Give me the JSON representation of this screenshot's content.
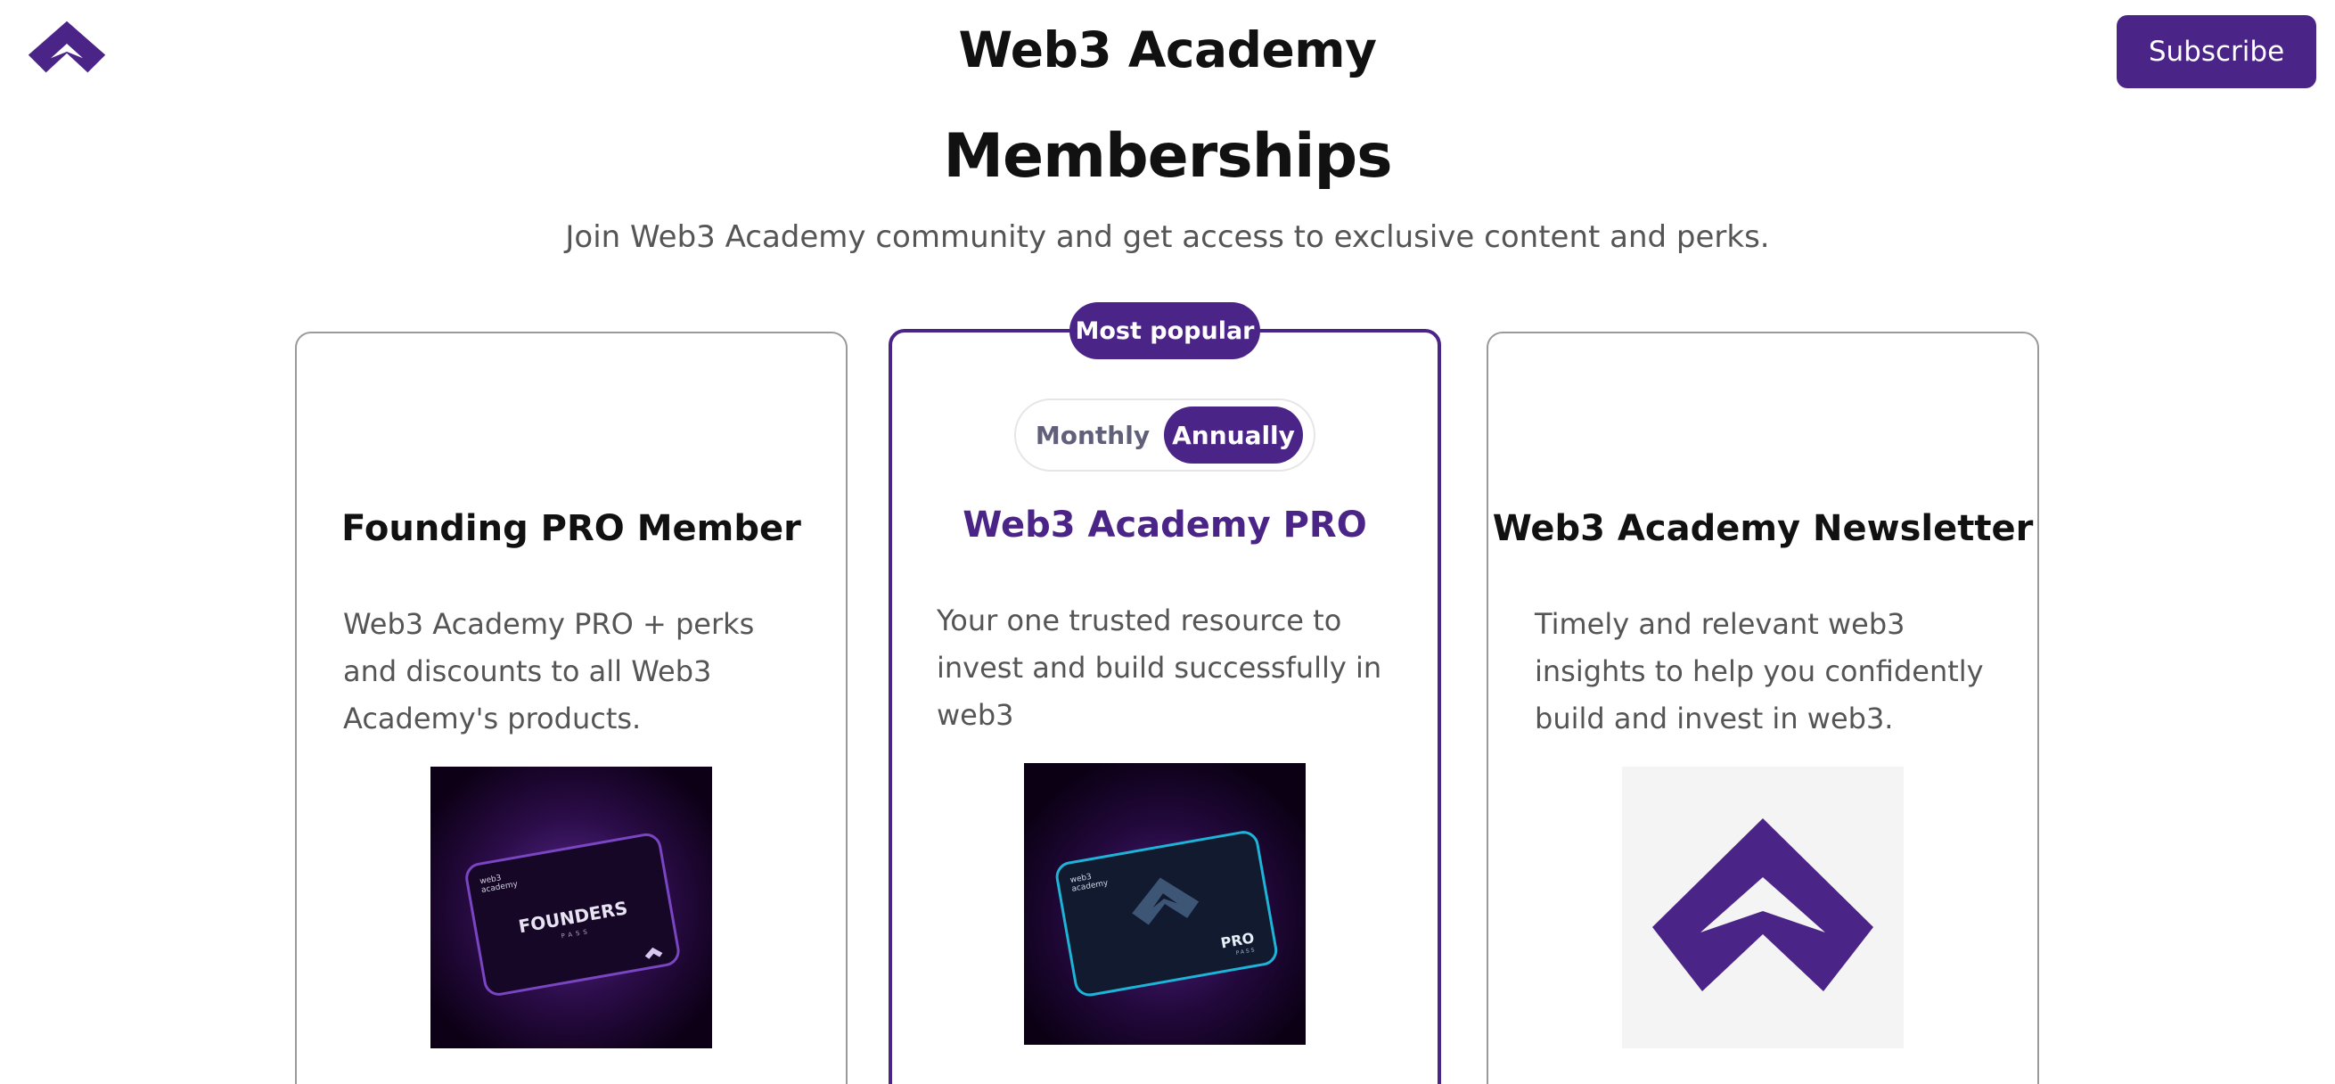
{
  "header": {
    "site_title": "Web3 Academy",
    "subscribe_label": "Subscribe"
  },
  "hero": {
    "heading": "Memberships",
    "subheading": "Join Web3 Academy community and get access to exclusive content and perks."
  },
  "plans": [
    {
      "title": "Founding PRO Member",
      "description": "Web3 Academy PRO + perks and discounts to all Web3 Academy's products.",
      "card_lines": [
        "web3",
        "academy"
      ],
      "card_text": "FOUNDERS",
      "card_subtext": "PASS"
    },
    {
      "badge": "Most popular",
      "billing_options": [
        "Monthly",
        "Annually"
      ],
      "selected_billing": "Annually",
      "title": "Web3 Academy PRO",
      "description": "Your one trusted resource to invest and build successfully in web3",
      "card_lines": [
        "web3",
        "academy"
      ],
      "card_text": "PRO",
      "card_subtext": "PASS"
    },
    {
      "title": "Web3 Academy Newsletter",
      "description": "Timely and relevant web3 insights to help you confidently build and invest in web3."
    }
  ],
  "colors": {
    "brand": "#4b2487",
    "text": "#111111",
    "muted": "#555555",
    "card_border": "#9a9a9a",
    "image_bg_dark": "#0d0016",
    "image_bg_light": "#f4f4f4"
  },
  "icons": {
    "logo": "web3-academy-logo-icon"
  }
}
